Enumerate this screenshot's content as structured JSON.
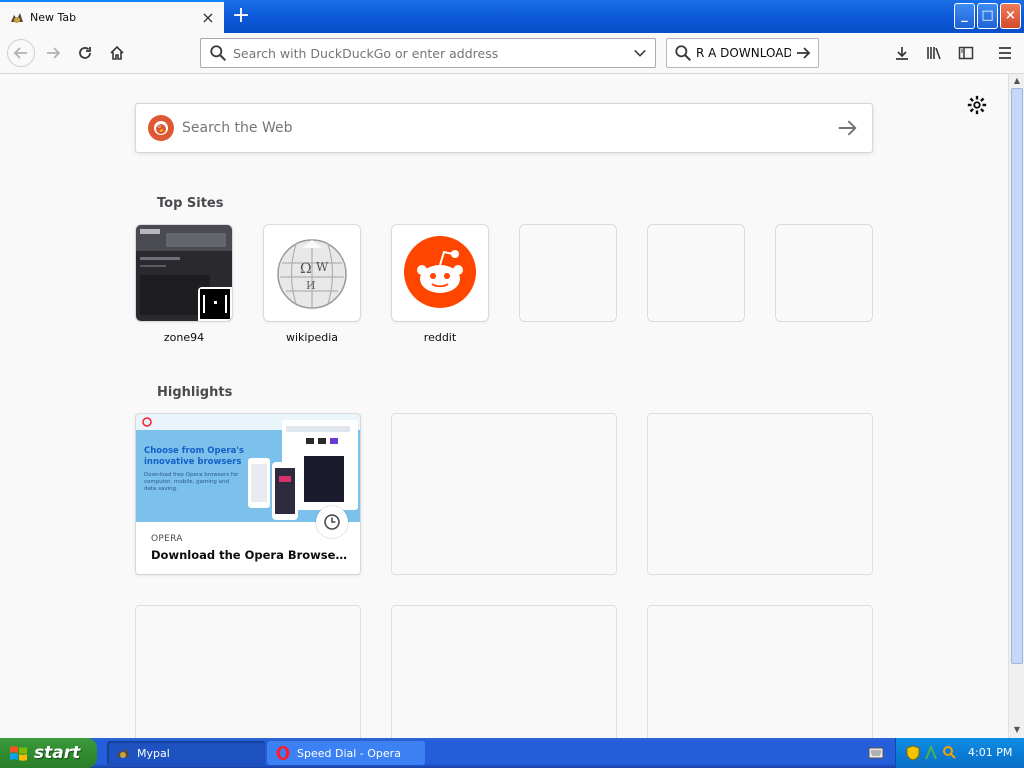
{
  "tab": {
    "title": "New Tab",
    "close_symbol": "×"
  },
  "window": {
    "minimize_symbol": "_",
    "maximize_symbol": "□",
    "close_symbol": "×"
  },
  "nav": {
    "url_placeholder": "Search with DuckDuckGo or enter address",
    "search_value": "R A DOWNLOAD"
  },
  "page": {
    "websearch_placeholder": "Search the Web",
    "top_sites_heading": "Top Sites",
    "top_sites": [
      {
        "label": "zone94"
      },
      {
        "label": "wikipedia"
      },
      {
        "label": "reddit"
      },
      {
        "label": ""
      },
      {
        "label": ""
      },
      {
        "label": ""
      }
    ],
    "highlights_heading": "Highlights",
    "highlight": {
      "source": "OPERA",
      "title": "Download the Opera Browser fo...",
      "thumb_heading": "Choose from Opera's innovative browsers",
      "thumb_sub": "Download free Opera browsers for computer, mobile, gaming and data saving."
    }
  },
  "taskbar": {
    "start_label": "start",
    "tasks": [
      {
        "label": "Mypal"
      },
      {
        "label": "Speed Dial - Opera"
      }
    ],
    "clock": "4:01 PM"
  },
  "colors": {
    "accent": "#0a84ff",
    "reddit": "#ff4500",
    "ddg": "#de5833",
    "xp_blue": "#245edb",
    "xp_green": "#2f8c2f"
  }
}
